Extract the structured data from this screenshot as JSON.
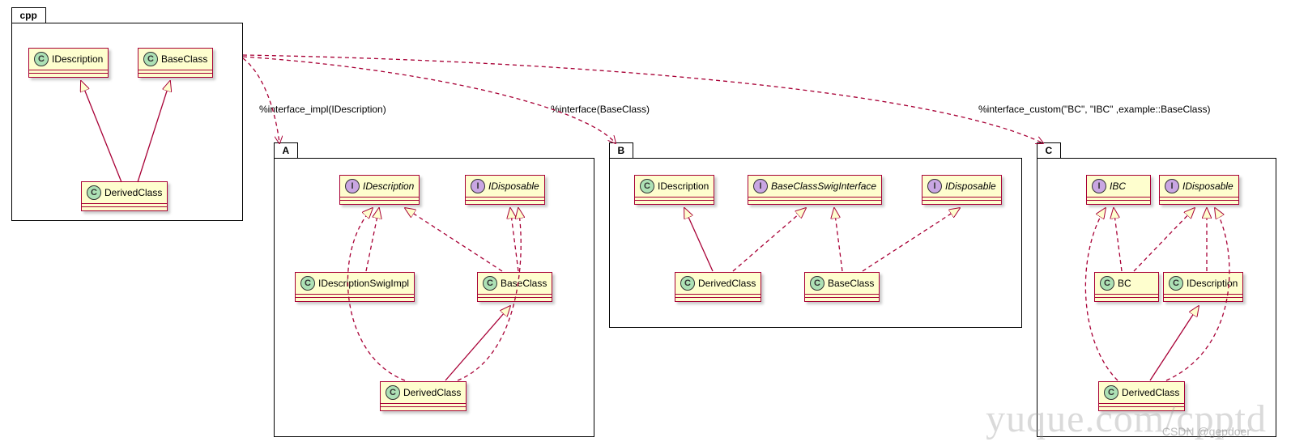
{
  "packages": {
    "cpp": {
      "label": "cpp",
      "classes": {
        "idesc": {
          "name": "IDescription",
          "stereo": "C"
        },
        "base": {
          "name": "BaseClass",
          "stereo": "C"
        },
        "derived": {
          "name": "DerivedClass",
          "stereo": "C"
        }
      }
    },
    "a": {
      "label": "A",
      "classes": {
        "idesc": {
          "name": "IDescription",
          "stereo": "I",
          "italic": true
        },
        "idisp": {
          "name": "IDisposable",
          "stereo": "I",
          "italic": true
        },
        "impimpl": {
          "name": "IDescriptionSwigImpl",
          "stereo": "C"
        },
        "base": {
          "name": "BaseClass",
          "stereo": "C"
        },
        "derived": {
          "name": "DerivedClass",
          "stereo": "C"
        }
      }
    },
    "b": {
      "label": "B",
      "classes": {
        "idesc": {
          "name": "IDescription",
          "stereo": "C"
        },
        "bswig": {
          "name": "BaseClassSwigInterface",
          "stereo": "I",
          "italic": true
        },
        "idisp": {
          "name": "IDisposable",
          "stereo": "I",
          "italic": true
        },
        "derived": {
          "name": "DerivedClass",
          "stereo": "C"
        },
        "base": {
          "name": "BaseClass",
          "stereo": "C"
        }
      }
    },
    "c": {
      "label": "C",
      "classes": {
        "ibc": {
          "name": "IBC",
          "stereo": "I",
          "italic": true
        },
        "idisp": {
          "name": "IDisposable",
          "stereo": "I",
          "italic": true
        },
        "bc": {
          "name": "BC",
          "stereo": "C"
        },
        "idesc": {
          "name": "IDescription",
          "stereo": "C"
        },
        "derived": {
          "name": "DerivedClass",
          "stereo": "C"
        }
      }
    }
  },
  "edge_labels": {
    "e1": "%interface_impl(IDescription)",
    "e2": "%interface(BaseClass)",
    "e3": "%interface_custom(\"BC\", \"IBC\" ,example::BaseClass)"
  },
  "watermarks": {
    "w1": "yuque.com/cpptd",
    "w2": "CSDN @gepdoer"
  }
}
